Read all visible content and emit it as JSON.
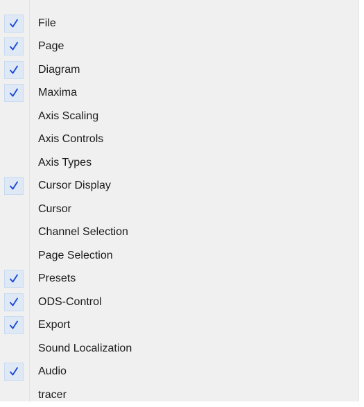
{
  "menu": {
    "items": [
      {
        "label": "File",
        "checked": true
      },
      {
        "label": "Page",
        "checked": true
      },
      {
        "label": "Diagram",
        "checked": true
      },
      {
        "label": "Maxima",
        "checked": true
      },
      {
        "label": "Axis Scaling",
        "checked": false
      },
      {
        "label": "Axis Controls",
        "checked": false
      },
      {
        "label": "Axis Types",
        "checked": false
      },
      {
        "label": "Cursor Display",
        "checked": true
      },
      {
        "label": "Cursor",
        "checked": false
      },
      {
        "label": "Channel Selection",
        "checked": false
      },
      {
        "label": "Page Selection",
        "checked": false
      },
      {
        "label": "Presets",
        "checked": true
      },
      {
        "label": "ODS-Control",
        "checked": true
      },
      {
        "label": "Export",
        "checked": true
      },
      {
        "label": "Sound Localization",
        "checked": false
      },
      {
        "label": "Audio",
        "checked": true
      },
      {
        "label": "tracer",
        "checked": false
      }
    ],
    "check_icon": "checkmark-icon",
    "check_color": "#1a49d6",
    "check_highlight": "#dfe9f6"
  }
}
